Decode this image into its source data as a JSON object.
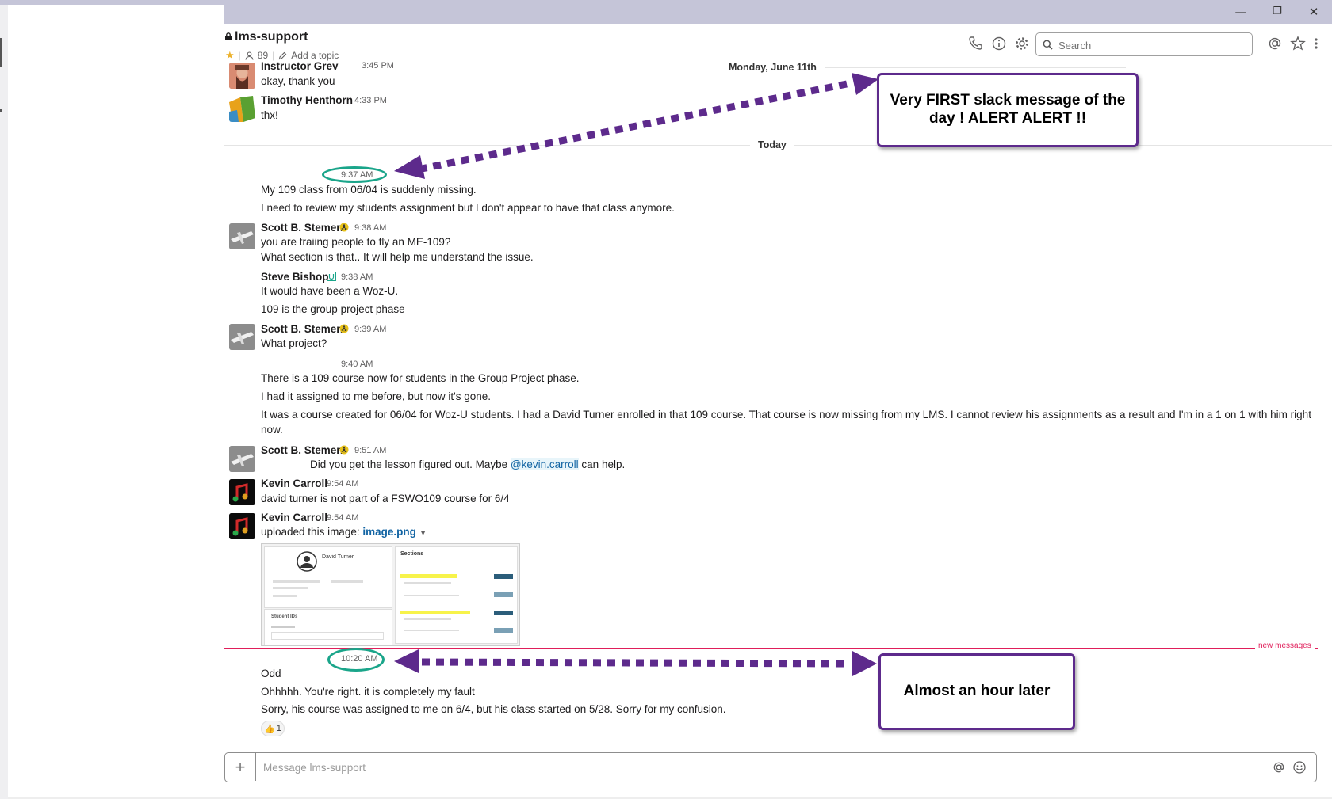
{
  "window": {
    "minimize": "—",
    "restore": "❐",
    "close": "✕"
  },
  "channel": {
    "name": "lms-support",
    "members": "89",
    "topic": "Add a topic"
  },
  "header": {
    "search_placeholder": "Search"
  },
  "day_dividers": {
    "previous": "Monday, June 11th",
    "today": "Today"
  },
  "messages": [
    {
      "author": "Instructor Grey",
      "time": "3:45 PM",
      "lines": [
        "okay, thank you"
      ]
    },
    {
      "author": "Timothy Henthorn",
      "time": "4:33 PM",
      "lines": [
        "thx!"
      ]
    },
    {
      "author": "",
      "time": "9:37 AM",
      "lines": [
        "My 109 class from 06/04 is suddenly missing.",
        "I need to review my students assignment but I don't appear to have that class anymore."
      ]
    },
    {
      "author": "Scott B. Stemen",
      "time": "9:38 AM",
      "lines": [
        "you are traiing people to fly an ME-109?",
        "What section is that.. It will help me understand the issue."
      ]
    },
    {
      "author": "Steve Bishop",
      "time": "9:38 AM",
      "lines": [
        "It would have been a Woz-U.",
        "109 is the group project phase"
      ]
    },
    {
      "author": "Scott B. Stemen",
      "time": "9:39 AM",
      "lines": [
        "What project?"
      ]
    },
    {
      "author": "",
      "time": "9:40 AM",
      "lines": [
        "There is a 109 course now for students in the Group Project phase.",
        "I had it assigned to me before, but now it's gone.",
        "It was a course created for 06/04 for Woz-U students.  I had a David Turner enrolled in that 109 course.  That course is now missing from my LMS.  I cannot review his assignments as a result and I'm in a 1 on 1 with him right",
        "now."
      ]
    },
    {
      "author": "Scott B. Stemen",
      "time": "9:51 AM",
      "lines": [
        "Did you get the lesson figured out.  Maybe",
        "@kevin.carroll",
        "can help."
      ]
    },
    {
      "author": "Kevin Carroll",
      "time": "9:54 AM",
      "lines": [
        "david turner is not part of a FSWO109 course for 6/4"
      ]
    },
    {
      "author": "Kevin Carroll",
      "time": "9:54 AM",
      "lines": [
        "uploaded this image:",
        "image.png"
      ]
    },
    {
      "author": "",
      "time": "10:20 AM",
      "lines": [
        "Odd",
        "Ohhhhh.  You're right.  it is completely my fault",
        "Sorry, his course was assigned to me on 6/4, but his class started on 5/28.  Sorry for my confusion."
      ]
    }
  ],
  "reaction": {
    "emoji": "👍",
    "count": "1"
  },
  "new_messages_label": "new messages",
  "attachment": {
    "profile_name": "David Turner",
    "panel_title": "Sections",
    "student_ids": "Student IDs"
  },
  "annotations": {
    "callout_top": "Very FIRST slack message of the day ! ALERT ALERT !!",
    "callout_bottom": "Almost an hour later"
  },
  "composer": {
    "placeholder": "Message lms-support"
  },
  "colors": {
    "annotation_purple": "#5d2a8c",
    "highlight_teal": "#1aa58a",
    "new_messages_red": "#e01e5a",
    "link_blue": "#1264a3"
  }
}
